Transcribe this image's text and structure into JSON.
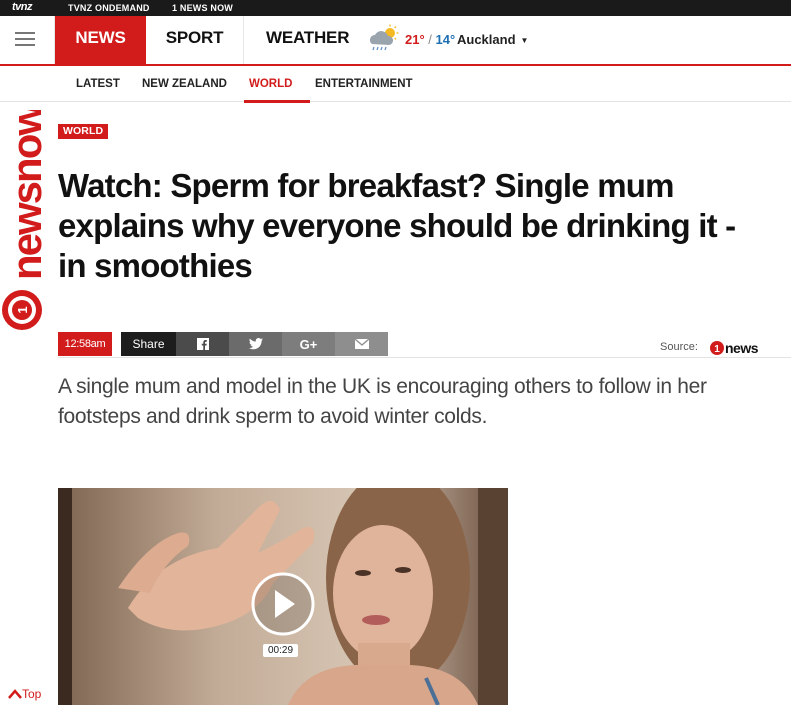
{
  "topbar": {
    "logo": "tvnz",
    "links": [
      "TVNZ ONDEMAND",
      "1 NEWS NOW"
    ]
  },
  "mainnav": {
    "tabs": [
      "NEWS",
      "SPORT",
      "WEATHER"
    ],
    "active_tab": "NEWS",
    "weather": {
      "icon": "cloud-rain-sun-icon",
      "high": "21°",
      "separator": "/",
      "low": "14°",
      "city": "Auckland"
    }
  },
  "subnav": {
    "items": [
      "LATEST",
      "NEW ZEALAND",
      "WORLD",
      "ENTERTAINMENT"
    ],
    "active": "WORLD"
  },
  "brand": {
    "text": "newsnow",
    "number": "1"
  },
  "article": {
    "tag": "WORLD",
    "headline": "Watch: Sperm for breakfast? Single mum explains why everyone should be drinking it - in smoothies",
    "time": "12:58am",
    "share_label": "Share",
    "share_icons": [
      "facebook-icon",
      "twitter-icon",
      "google-plus-icon",
      "email-icon"
    ],
    "source_label": "Source:",
    "source_logo": "news",
    "source_logo_number": "1",
    "summary": "A single mum and model in the UK is encouraging others to follow in her footsteps and drink sperm to avoid winter colds.",
    "video": {
      "duration": "00:29"
    }
  },
  "footer": {
    "top_link": "Top"
  },
  "colors": {
    "accent": "#d21c1c",
    "dark": "#1a1a1a",
    "temp_low": "#1f6fb3"
  }
}
